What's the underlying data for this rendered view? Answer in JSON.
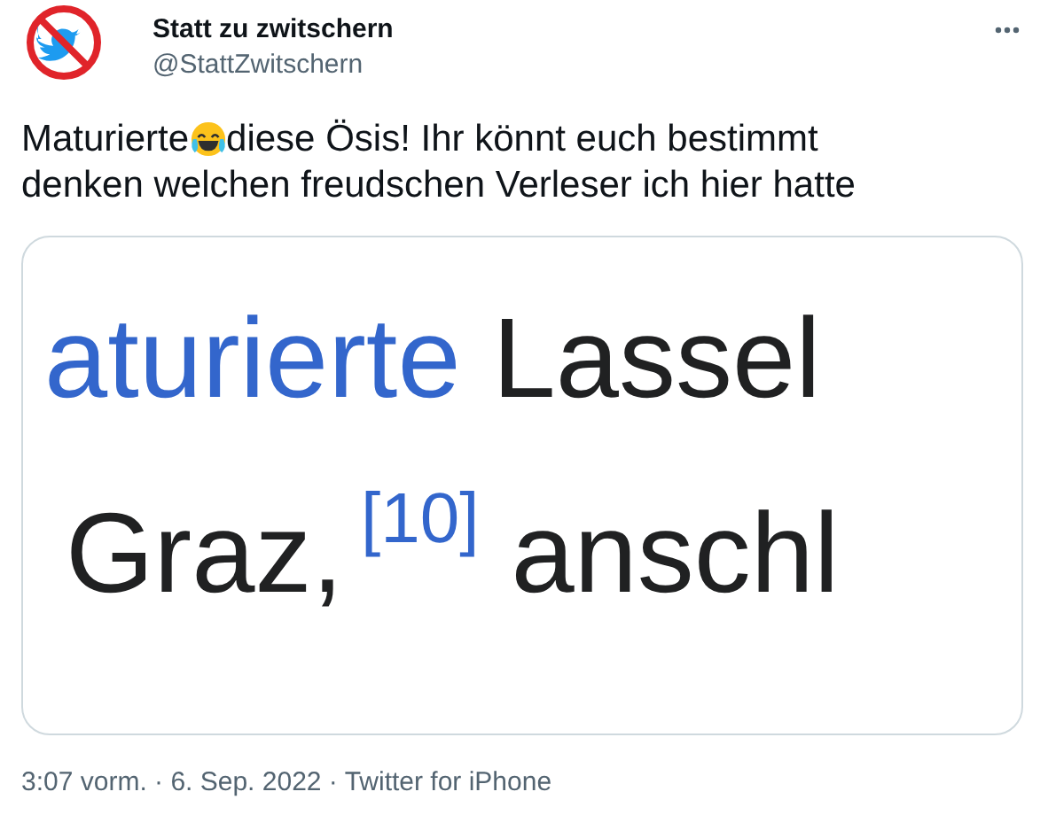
{
  "author": {
    "name": "Statt zu zwitschern",
    "handle": "@StattZwitschern"
  },
  "tweet": {
    "text_before_emoji": "Maturierte",
    "text_after_emoji": "diese Ösis! Ihr könnt euch bestimmt",
    "text_line_2": "denken welchen freudschen Verleser ich hier hatte"
  },
  "image": {
    "lines": [
      [
        {
          "kind": "link",
          "text": "aturierte"
        },
        {
          "kind": "plain",
          "text": "Lassel"
        }
      ],
      [
        {
          "kind": "plain",
          "text": "Graz,"
        },
        {
          "kind": "ref",
          "text": "[10]"
        },
        {
          "kind": "plain",
          "text": "anschl"
        }
      ]
    ]
  },
  "meta": "3:07 vorm. · 6. Sep. 2022 · Twitter for iPhone"
}
